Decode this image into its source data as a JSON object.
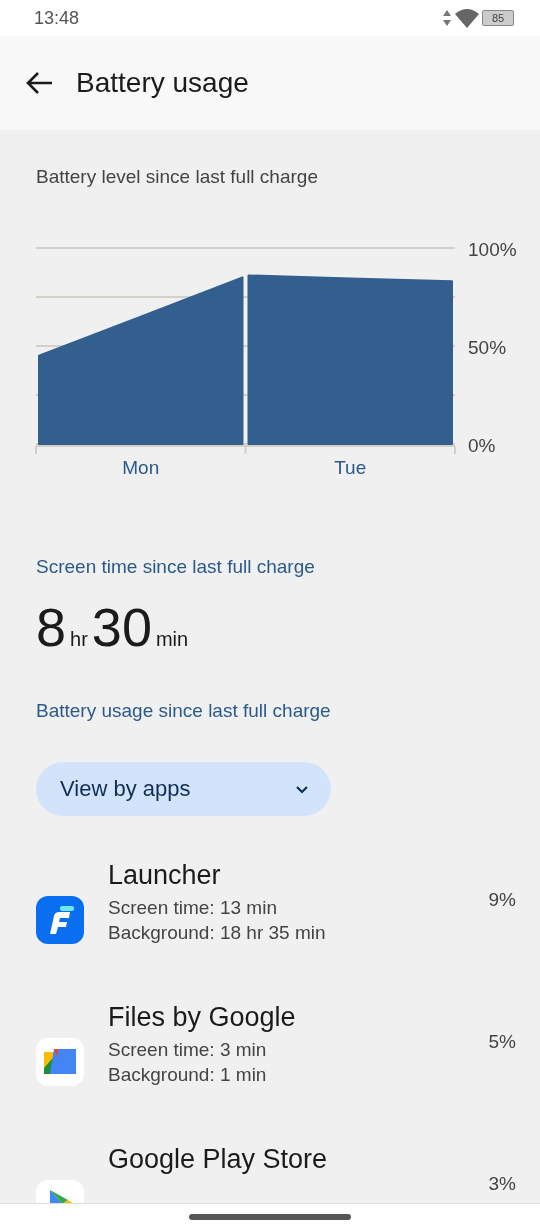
{
  "status_bar": {
    "time": "13:48",
    "battery_text": "85"
  },
  "app_bar": {
    "title": "Battery usage"
  },
  "battery_chart": {
    "heading": "Battery level since last full charge",
    "chart_data": {
      "type": "area",
      "categories": [
        null,
        "Mon",
        null,
        "Tue",
        null
      ],
      "ylim": [
        0,
        100
      ],
      "yticks": [
        {
          "value": 0,
          "label": "0%"
        },
        {
          "value": 50,
          "label": "50%"
        },
        {
          "value": 100,
          "label": "100%"
        }
      ],
      "series": [
        {
          "color": "#335f8f",
          "values": [
            45,
            65,
            85,
            null,
            null
          ]
        },
        {
          "color": "#335f8f",
          "values": [
            null,
            null,
            86,
            84.5,
            83
          ]
        }
      ]
    }
  },
  "screen_time": {
    "heading": "Screen time since last full charge",
    "hours": "8",
    "hours_unit": "hr",
    "minutes": "30",
    "minutes_unit": "min"
  },
  "usage": {
    "heading": "Battery usage since last full charge",
    "dropdown": "View by apps"
  },
  "apps": [
    {
      "kind": "launcher",
      "name": "Launcher",
      "screen_time": "Screen time: 13 min",
      "background": "Background: 18 hr 35 min",
      "percent": "9%"
    },
    {
      "kind": "files",
      "name": "Files by Google",
      "screen_time": "Screen time: 3 min",
      "background": "Background: 1 min",
      "percent": "5%"
    },
    {
      "kind": "play",
      "name": "Google Play Store",
      "percent": "3%"
    }
  ]
}
